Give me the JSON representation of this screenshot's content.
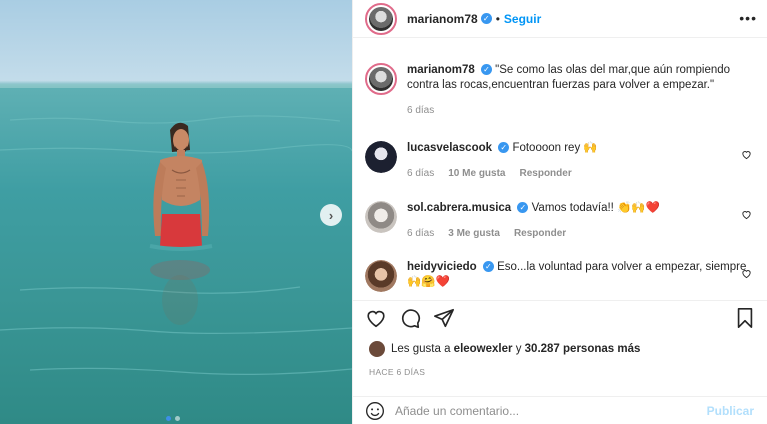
{
  "post": {
    "username": "marianom78",
    "separator": "•",
    "follow_label": "Seguir",
    "more_icon": "more-horizontal-icon"
  },
  "caption": {
    "username": "marianom78",
    "text": "\"Se como las olas del mar,que aún rompiendo contra las rocas,encuentran fuerzas para volver a empezar.\"",
    "age": "6 días"
  },
  "comments": [
    {
      "username": "lucasvelascook",
      "text": "Fotoooon rey 🙌",
      "age": "6 días",
      "likes": "10 Me gusta",
      "reply": "Responder"
    },
    {
      "username": "sol.cabrera.musica",
      "text": "Vamos todavía!! 👏🙌❤️",
      "age": "6 días",
      "likes": "3 Me gusta",
      "reply": "Responder"
    },
    {
      "username": "heidyviciedo",
      "text": "Eso...la voluntad para volver a empezar, siempre🙌🤗❤️"
    }
  ],
  "likes": {
    "prefix": "Les gusta a",
    "user": "eleowexler",
    "connector": "y",
    "count": "30.287 personas más"
  },
  "timestamp": "HACE 6 DÍAS",
  "comment_box": {
    "placeholder": "Añade un comentario...",
    "publish_label": "Publicar"
  },
  "carousel": {
    "total": 2,
    "active": 1
  },
  "colors": {
    "accent": "#0095f6",
    "verified": "#3897f0",
    "publish_disabled": "#b2dffc",
    "heart_red": "#ed4956"
  }
}
